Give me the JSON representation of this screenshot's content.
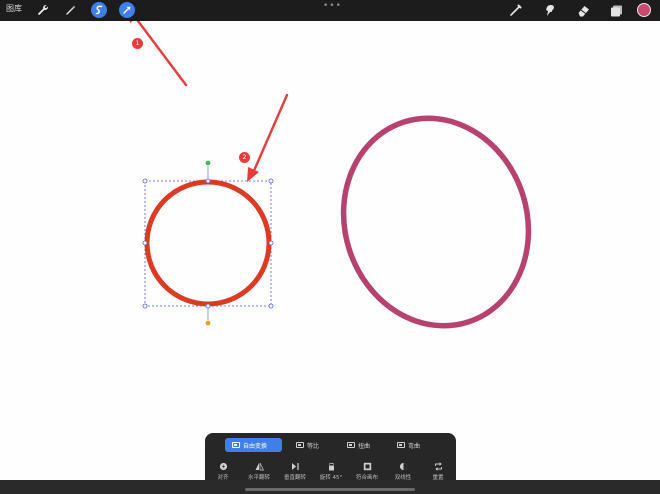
{
  "topbar": {
    "gallery_label": "图库",
    "more_dots": "•••",
    "color_well": "#c94a6d",
    "left_tools": [
      {
        "icon": "wrench-icon",
        "active": false
      },
      {
        "icon": "magic-wand-icon",
        "active": false
      },
      {
        "icon": "selection-icon",
        "active": true
      },
      {
        "icon": "transform-arrow-icon",
        "active": true
      }
    ],
    "right_tools": [
      "brush-icon",
      "smudge-icon",
      "eraser-icon",
      "layers-icon"
    ]
  },
  "annotations": {
    "marker_1": "1",
    "marker_2": "2",
    "color": "#e63c3c"
  },
  "canvas": {
    "circle_stroke": "#dc3a22",
    "ellipse_stroke": "#b8426f",
    "bbox_color": "#4a62d8",
    "rotate_handle_color": "#3cbf5a",
    "pivot_handle_color": "#f0a020"
  },
  "panel": {
    "modes": [
      {
        "label": "自由变换",
        "active": true
      },
      {
        "label": "等比",
        "active": false
      },
      {
        "label": "扭曲",
        "active": false
      },
      {
        "label": "弯曲",
        "active": false
      }
    ],
    "tools": [
      {
        "label": "对齐",
        "icon": "snap-icon"
      },
      {
        "label": "水平翻转",
        "icon": "flip-horizontal-icon"
      },
      {
        "label": "垂直翻转",
        "icon": "flip-vertical-icon"
      },
      {
        "label": "旋转 45°",
        "icon": "rotate-45-icon"
      },
      {
        "label": "符合画布",
        "icon": "fit-canvas-icon"
      },
      {
        "label": "双线性",
        "icon": "bilinear-icon"
      },
      {
        "label": "重置",
        "icon": "reset-icon"
      }
    ]
  }
}
